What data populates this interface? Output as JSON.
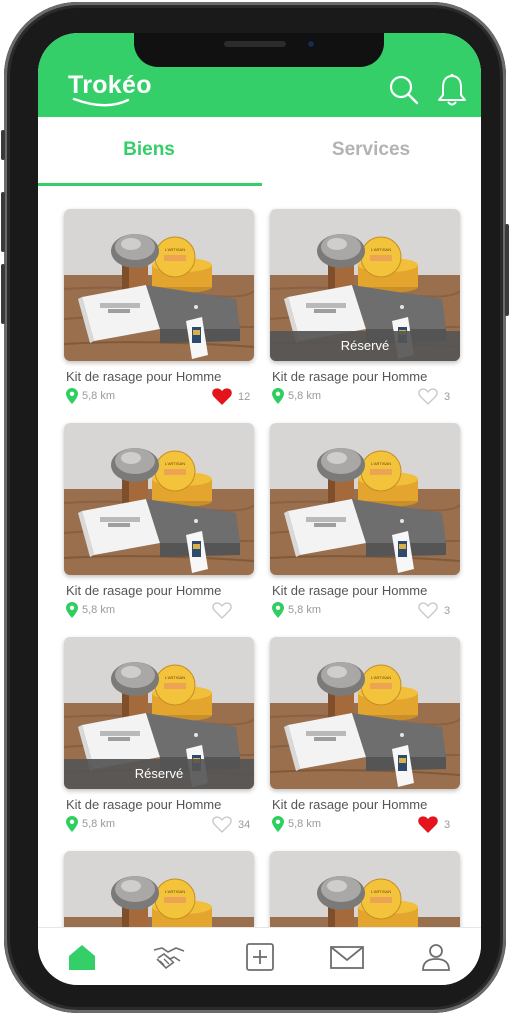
{
  "app": {
    "logo": "Trokéo",
    "accent": "#35cf6a"
  },
  "header": {
    "icons": [
      "search-icon",
      "bell-icon"
    ]
  },
  "tabs": [
    {
      "label": "Biens",
      "active": true
    },
    {
      "label": "Services",
      "active": false
    }
  ],
  "items": [
    {
      "title": "Kit de rasage pour Homme",
      "distance": "5,8 km",
      "likes": "12",
      "liked": true,
      "reserved": false
    },
    {
      "title": "Kit de rasage pour Homme",
      "distance": "5,8 km",
      "likes": "3",
      "liked": false,
      "reserved": true,
      "reserved_label": "Réservé"
    },
    {
      "title": "Kit de rasage pour Homme",
      "distance": "5,8 km",
      "likes": "",
      "liked": false,
      "reserved": false
    },
    {
      "title": "Kit de rasage pour Homme",
      "distance": "5,8 km",
      "likes": "3",
      "liked": false,
      "reserved": false
    },
    {
      "title": "Kit de rasage pour Homme",
      "distance": "5,8 km",
      "likes": "34",
      "liked": false,
      "reserved": true,
      "reserved_label": "Réservé"
    },
    {
      "title": "Kit de rasage pour Homme",
      "distance": "5,8 km",
      "likes": "3",
      "liked": true,
      "reserved": false
    },
    {
      "title": "",
      "distance": "",
      "likes": "",
      "liked": false,
      "reserved": false
    },
    {
      "title": "",
      "distance": "",
      "likes": "",
      "liked": false,
      "reserved": false
    }
  ],
  "bottom_nav": [
    "home-icon",
    "handshake-icon",
    "add-icon",
    "mail-icon",
    "profile-icon"
  ]
}
